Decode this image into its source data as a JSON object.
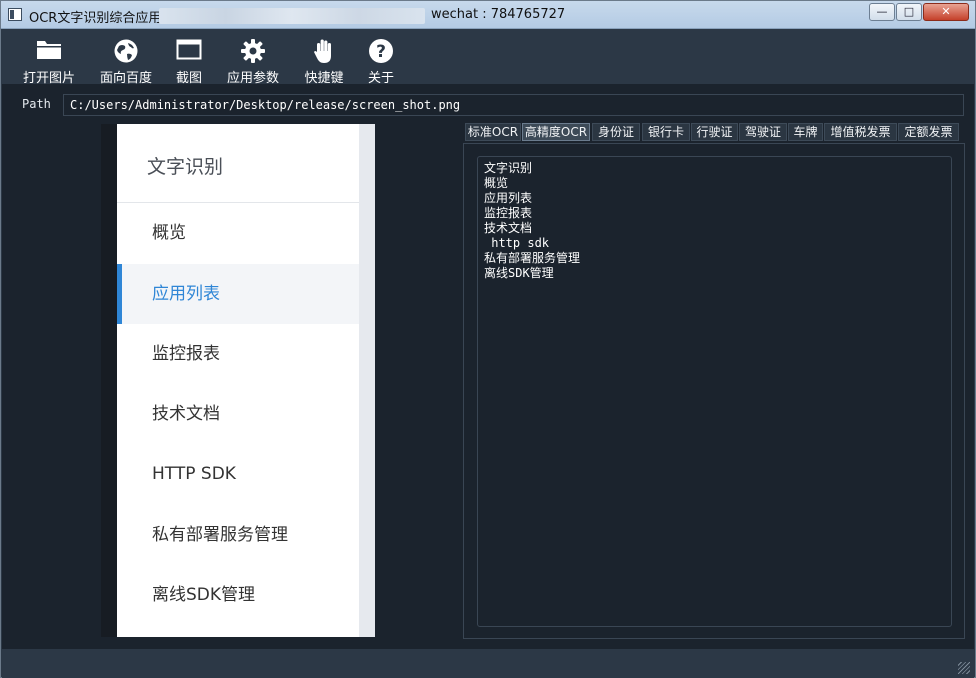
{
  "window": {
    "title": "OCR文字识别综合应用",
    "subtitle": "wechat : 784765727",
    "controls": {
      "minimize": "—",
      "maximize": "□",
      "close": "✕"
    }
  },
  "toolbar": {
    "items": [
      {
        "label": "打开图片",
        "icon": "folder-icon"
      },
      {
        "label": "面向百度",
        "icon": "globe-icon"
      },
      {
        "label": "截图",
        "icon": "window-icon"
      },
      {
        "label": "应用参数",
        "icon": "gear-icon"
      },
      {
        "label": "快捷键",
        "icon": "hand-icon"
      },
      {
        "label": "关于",
        "icon": "help-icon"
      }
    ]
  },
  "path": {
    "label": "Path",
    "value": "C:/Users/Administrator/Desktop/release/screen_shot.png"
  },
  "preview": {
    "title": "文字识别",
    "items": [
      {
        "label": "概览",
        "active": false
      },
      {
        "label": "应用列表",
        "active": true
      },
      {
        "label": "监控报表",
        "active": false
      },
      {
        "label": "技术文档",
        "active": false
      },
      {
        "label": "HTTP SDK",
        "active": false
      },
      {
        "label": "私有部署服务管理",
        "active": false
      },
      {
        "label": "离线SDK管理",
        "active": false
      }
    ],
    "accent_color": "#2f86d6"
  },
  "tabs": [
    {
      "label": "标准OCR",
      "active": false
    },
    {
      "label": "高精度OCR",
      "active": true
    },
    {
      "label": "身份证",
      "active": false
    },
    {
      "label": "银行卡",
      "active": false
    },
    {
      "label": "行驶证",
      "active": false
    },
    {
      "label": "驾驶证",
      "active": false
    },
    {
      "label": "车牌",
      "active": false
    },
    {
      "label": "增值税发票",
      "active": false
    },
    {
      "label": "定额发票",
      "active": false
    }
  ],
  "result": {
    "lines": [
      "文字识别",
      "概览",
      "应用列表",
      "监控报表",
      "技术文档",
      " http sdk",
      "私有部署服务管理",
      "离线SDK管理"
    ]
  }
}
